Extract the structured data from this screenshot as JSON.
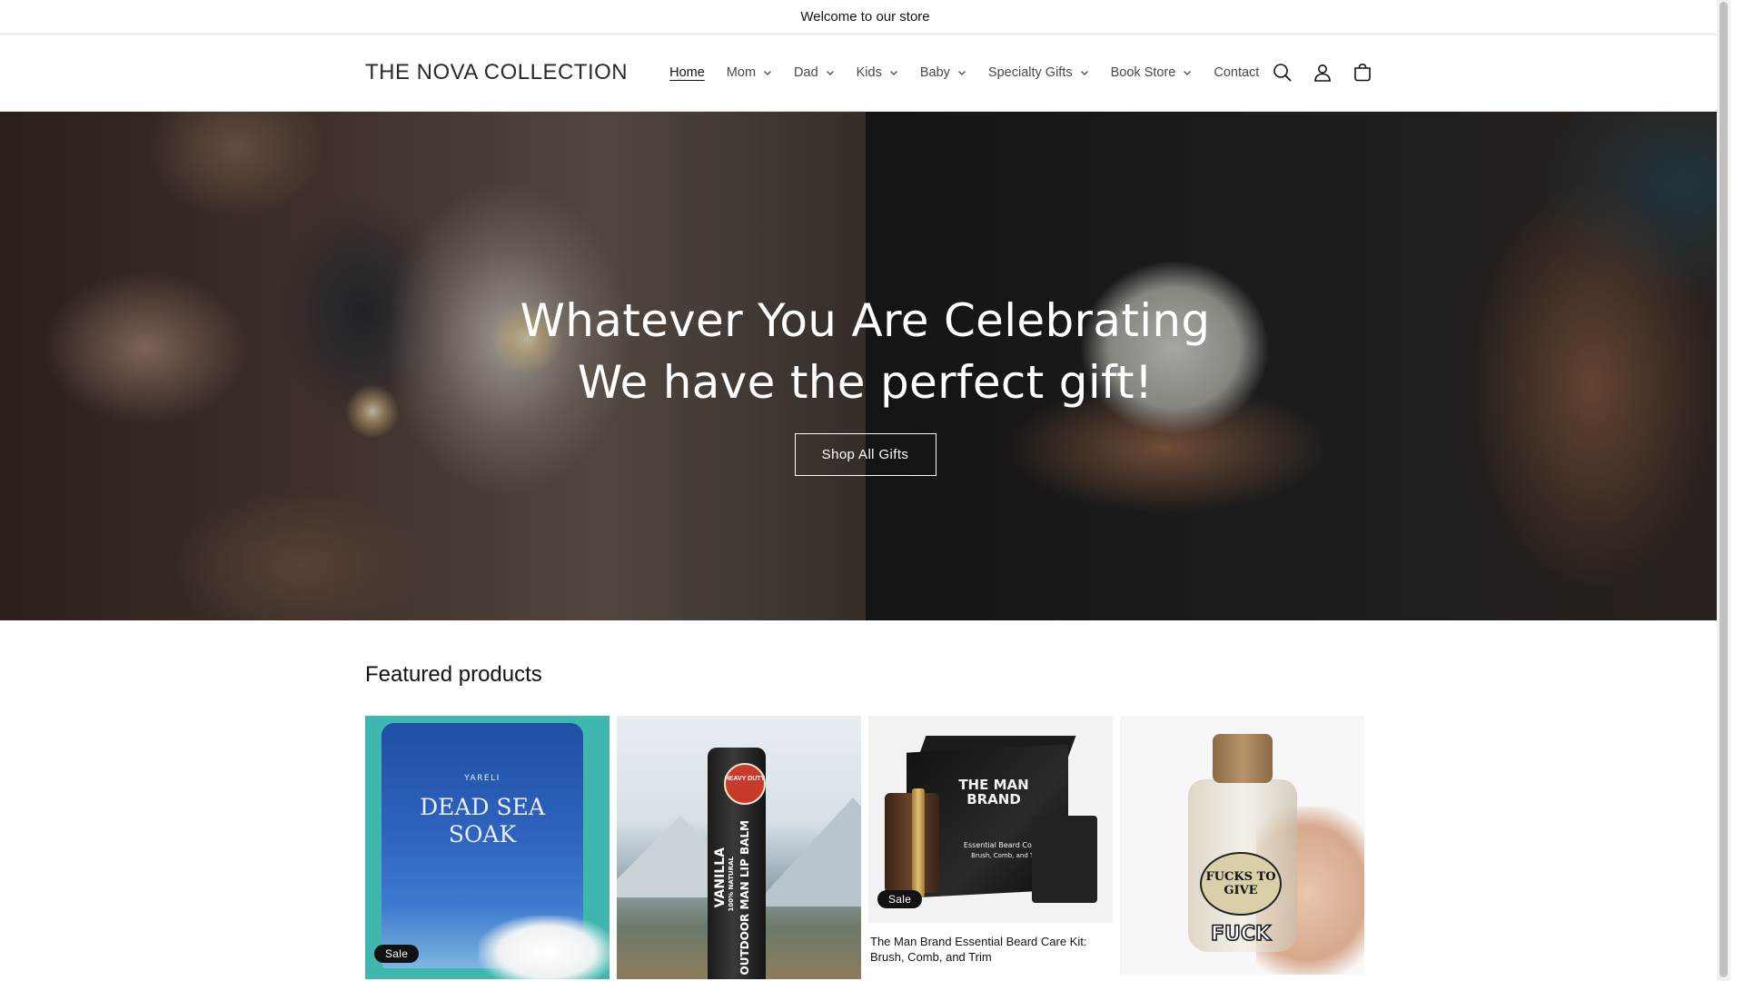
{
  "announcement": {
    "text": "Welcome to our store"
  },
  "header": {
    "logo": "THE NOVA COLLECTION",
    "nav": [
      {
        "label": "Home",
        "active": true,
        "dropdown": false
      },
      {
        "label": "Mom",
        "dropdown": true
      },
      {
        "label": "Dad",
        "dropdown": true
      },
      {
        "label": "Kids",
        "dropdown": true
      },
      {
        "label": "Baby",
        "dropdown": true
      },
      {
        "label": "Specialty Gifts",
        "dropdown": true
      },
      {
        "label": "Book Store",
        "dropdown": true
      },
      {
        "label": "Contact",
        "dropdown": false
      }
    ],
    "icons": [
      "search-icon",
      "account-icon",
      "cart-icon"
    ]
  },
  "hero": {
    "line1": "Whatever You Are Celebrating",
    "line2": "We have the perfect gift!",
    "button": "Shop All Gifts"
  },
  "featured": {
    "title": "Featured products",
    "products": [
      {
        "name": "",
        "badge": "Sale",
        "image_text": {
          "brand": "YARELI",
          "title1": "DEAD SEA",
          "title2": "SOAK"
        }
      },
      {
        "name": "",
        "badge": "",
        "image_text": {
          "brand": "HEAVY DUTY",
          "title": "OUTDOOR MAN LIP BALM",
          "sub": "100% NATURAL",
          "flavor": "VANILLA"
        }
      },
      {
        "name": "The Man Brand Essential Beard Care Kit: Brush, Comb, and Trim",
        "badge": "Sale",
        "image_text": {
          "brand": "THE MAN BRAND",
          "line": "Essential Beard Core Kit",
          "line2": "Brush, Comb, and Trim"
        }
      },
      {
        "name": "",
        "badge": "",
        "image_text": {
          "label": "FUCKS TO GIVE",
          "word": "FUCK"
        }
      }
    ]
  },
  "colors": {
    "badge": "#121212",
    "text": "#121212",
    "hero_text": "#ffffff"
  }
}
